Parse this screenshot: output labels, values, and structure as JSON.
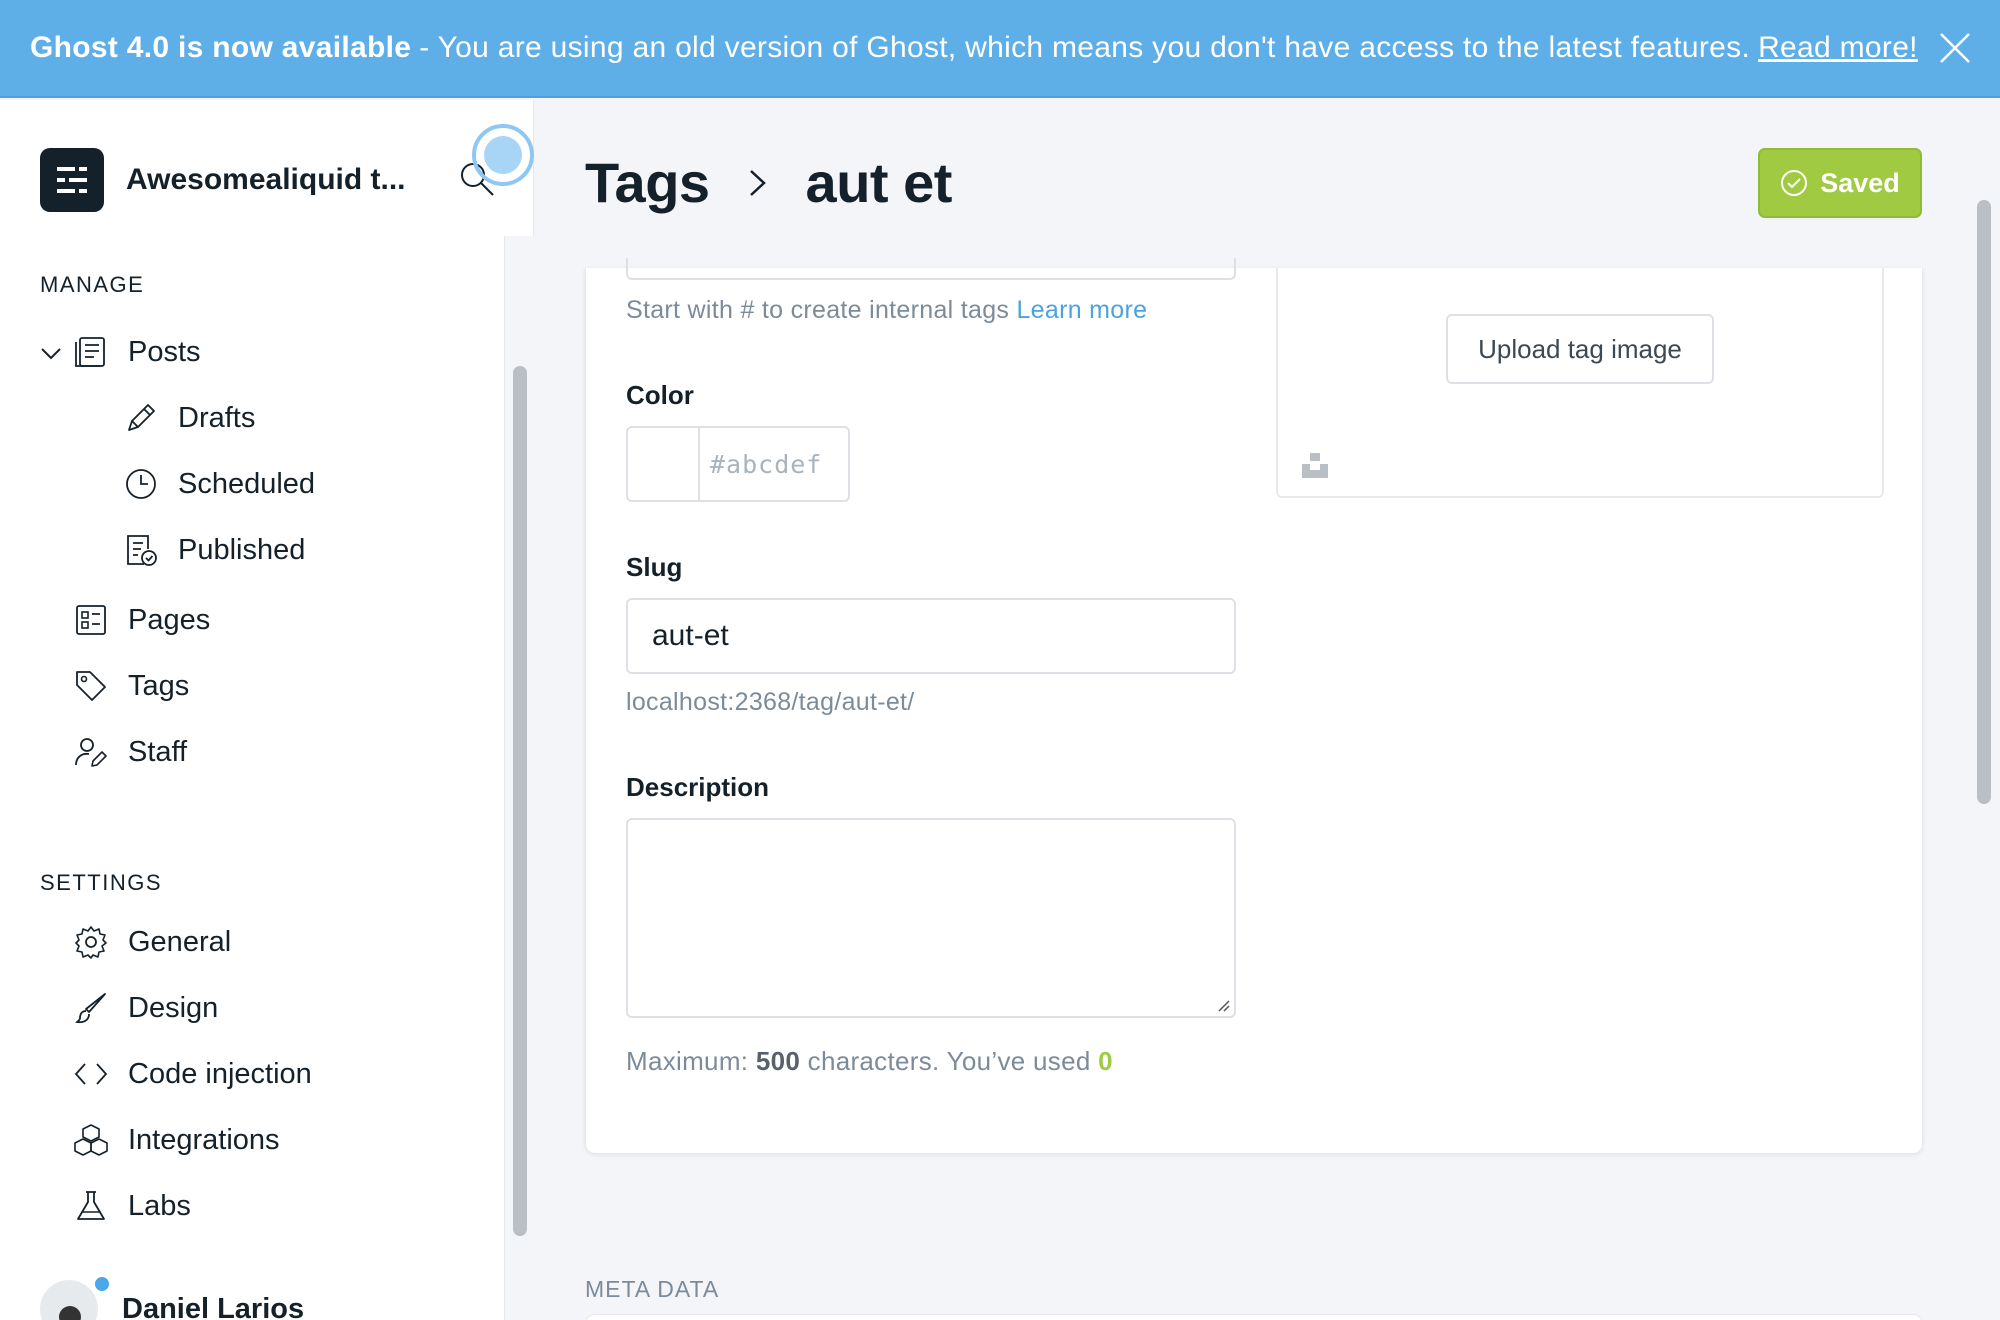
{
  "banner": {
    "headline": "Ghost 4.0 is now available",
    "separator": "-",
    "message": "You are using an old version of Ghost, which means you don't have access to the latest features.",
    "link": "Read more!",
    "bg_color": "#5eaee8"
  },
  "sidebar": {
    "site_title": "Awesomealiquid t...",
    "manage_label": "MANAGE",
    "settings_label": "SETTINGS",
    "manage_items": [
      {
        "label": "Posts",
        "icon": "posts-icon"
      },
      {
        "label": "Drafts",
        "icon": "pencil-icon"
      },
      {
        "label": "Scheduled",
        "icon": "clock-icon"
      },
      {
        "label": "Published",
        "icon": "published-icon"
      },
      {
        "label": "Pages",
        "icon": "pages-icon"
      },
      {
        "label": "Tags",
        "icon": "tag-icon"
      },
      {
        "label": "Staff",
        "icon": "staff-icon"
      }
    ],
    "settings_items": [
      {
        "label": "General",
        "icon": "gear-icon"
      },
      {
        "label": "Design",
        "icon": "brush-icon"
      },
      {
        "label": "Code injection",
        "icon": "code-icon"
      },
      {
        "label": "Integrations",
        "icon": "integrations-icon"
      },
      {
        "label": "Labs",
        "icon": "flask-icon"
      }
    ],
    "user_name": "Daniel Larios"
  },
  "header": {
    "breadcrumb_parent": "Tags",
    "breadcrumb_current": "aut et",
    "saved_label": "Saved",
    "saved_color": "#9fca41"
  },
  "form": {
    "name_help": "Start with # to create internal tags",
    "name_help_link": "Learn more",
    "color_label": "Color",
    "color_placeholder": "#abcdef",
    "slug_label": "Slug",
    "slug_value": "aut-et",
    "slug_url": "localhost:2368/tag/aut-et/",
    "description_label": "Description",
    "counter_prefix": "Maximum:",
    "counter_max": "500",
    "counter_mid": "characters. You’ve used",
    "counter_used": "0",
    "upload_label": "Upload tag image"
  },
  "meta": {
    "section_label": "META DATA"
  }
}
